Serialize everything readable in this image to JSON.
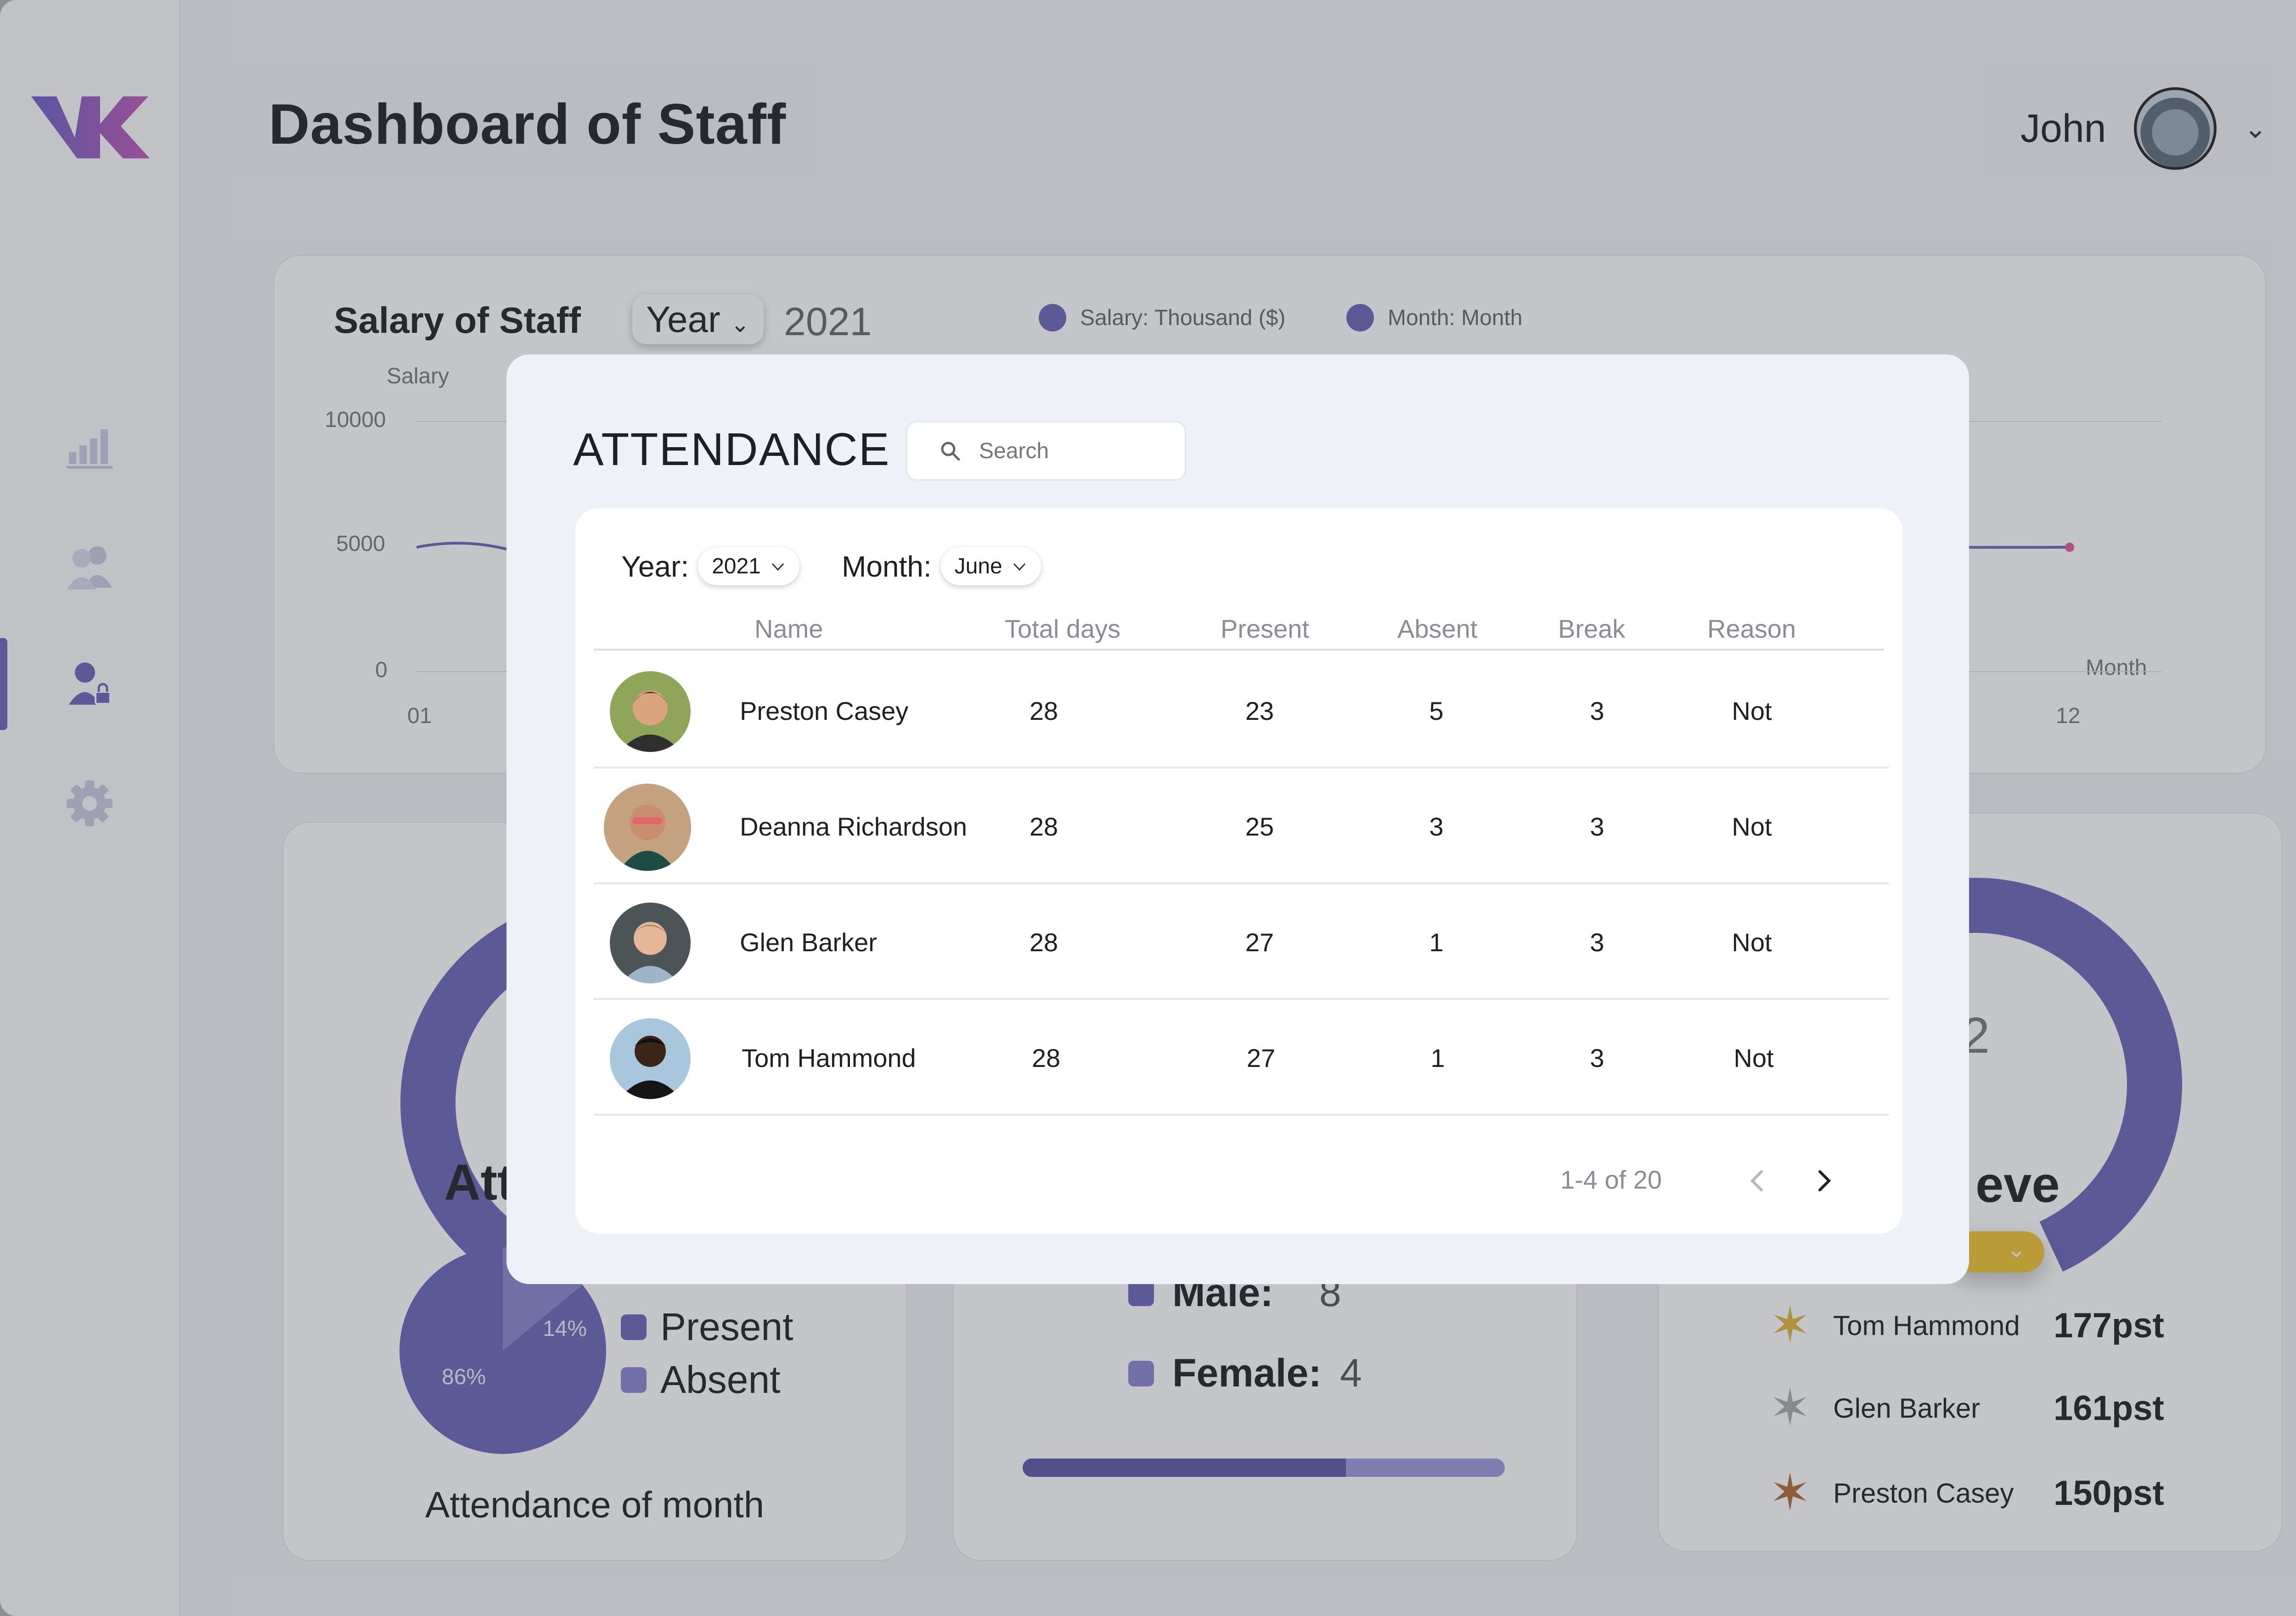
{
  "header": {
    "title": "Dashboard of Staff",
    "user_name": "John"
  },
  "sidebar": {
    "icons": [
      "bar-chart-icon",
      "users-icon",
      "user-lock-icon",
      "gear-icon"
    ],
    "active_index": 2
  },
  "salary": {
    "title": "Salary of Staff",
    "period_select": "Year",
    "year": "2021",
    "legend": [
      "Salary: Thousand ($)",
      "Month: Month"
    ],
    "y_axis_title": "Salary",
    "x_axis_title": "Month",
    "y_ticks": [
      "10000",
      "5000",
      "0"
    ],
    "x_ticks": [
      "01",
      "12"
    ]
  },
  "attendance_card": {
    "title_fragment": "Att",
    "slices": [
      {
        "name": "Present",
        "percent": 86
      },
      {
        "name": "Absent",
        "percent": 14
      }
    ],
    "present_label": "86%",
    "absent_label": "14%",
    "legend_present": "Present",
    "legend_absent": "Absent",
    "caption": "Attendance of month"
  },
  "gender_card": {
    "male_label": "Male:",
    "male_value": "8",
    "female_label": "Female:",
    "female_value": "4",
    "male_fraction": 0.67
  },
  "top_card": {
    "title_fragment": "eve",
    "center_fragment": "2",
    "ranking": [
      {
        "name": "Tom Hammond",
        "points": "177pst",
        "medal": "gold"
      },
      {
        "name": "Glen Barker",
        "points": "161pst",
        "medal": "silver"
      },
      {
        "name": "Preston Casey",
        "points": "150pst",
        "medal": "bronze"
      }
    ]
  },
  "modal": {
    "title": "ATTENDANCE",
    "search_placeholder": "Search",
    "filters": {
      "year_label": "Year:",
      "year_value": "2021",
      "month_label": "Month:",
      "month_value": "June"
    },
    "columns": [
      "Name",
      "Total days",
      "Present",
      "Absent",
      "Break",
      "Reason"
    ],
    "rows": [
      {
        "name": "Preston Casey",
        "total_days": "28",
        "present": "23",
        "absent": "5",
        "break": "3",
        "reason": "Not"
      },
      {
        "name": "Deanna Richardson",
        "total_days": "28",
        "present": "25",
        "absent": "3",
        "break": "3",
        "reason": "Not"
      },
      {
        "name": "Glen Barker",
        "total_days": "28",
        "present": "27",
        "absent": "1",
        "break": "3",
        "reason": "Not"
      },
      {
        "name": "Tom Hammond",
        "total_days": "28",
        "present": "27",
        "absent": "1",
        "break": "3",
        "reason": "Not"
      }
    ],
    "pagination": "1-4 of 20"
  },
  "colors": {
    "accent": "#6a66b8",
    "accent_light": "#8a87d0",
    "gold": "#f0c431",
    "silver": "#a9a9a9",
    "bronze": "#b06a35"
  }
}
